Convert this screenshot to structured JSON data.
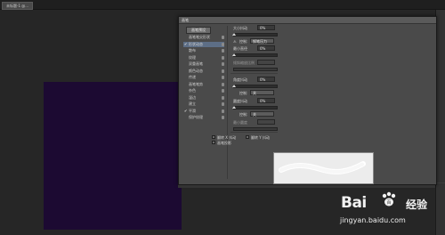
{
  "document": {
    "tab_label": "未标题-1 @..."
  },
  "dialog": {
    "title": "画笔",
    "preset_button": "画笔预设",
    "left_items": [
      {
        "label": "画笔笔尖形状",
        "checked": false,
        "selected": false
      },
      {
        "label": "形状动态",
        "checked": true,
        "selected": true
      },
      {
        "label": "散布",
        "checked": false,
        "selected": false
      },
      {
        "label": "纹理",
        "checked": false,
        "selected": false
      },
      {
        "label": "双重画笔",
        "checked": false,
        "selected": false
      },
      {
        "label": "颜色动态",
        "checked": false,
        "selected": false
      },
      {
        "label": "传递",
        "checked": false,
        "selected": false
      },
      {
        "label": "画笔笔势",
        "checked": false,
        "selected": false
      },
      {
        "label": "杂色",
        "checked": false,
        "selected": false
      },
      {
        "label": "湿边",
        "checked": false,
        "selected": false
      },
      {
        "label": "建立",
        "checked": false,
        "selected": false
      },
      {
        "label": "平滑",
        "checked": true,
        "selected": false
      },
      {
        "label": "保护纹理",
        "checked": false,
        "selected": false
      }
    ],
    "params": {
      "size_jitter_label": "大小抖动",
      "size_jitter_value": "0%",
      "control_label": "控制:",
      "control_value_1": "钢笔压力",
      "min_diameter_label": "最小直径",
      "min_diameter_value": "0%",
      "tilt_scale_label": "倾斜缩放比例",
      "angle_jitter_label": "角度抖动",
      "angle_jitter_value": "0%",
      "control_value_2": "关",
      "roundness_jitter_label": "圆度抖动",
      "roundness_jitter_value": "0%",
      "control_value_3": "关",
      "min_roundness_label": "最小圆度",
      "flip_x_label": "翻转 X 抖动",
      "flip_y_label": "翻转 Y 抖动",
      "brush_projection_label": "画笔投影"
    }
  },
  "watermark": {
    "logo_left": "Bai",
    "logo_right": "百",
    "logo_cn": "经验",
    "url": "jingyan.baidu.com"
  },
  "colors": {
    "canvas": "#1c0a32",
    "dialog_bg": "#4a4a4a",
    "selected_item": "#5d6e86"
  }
}
